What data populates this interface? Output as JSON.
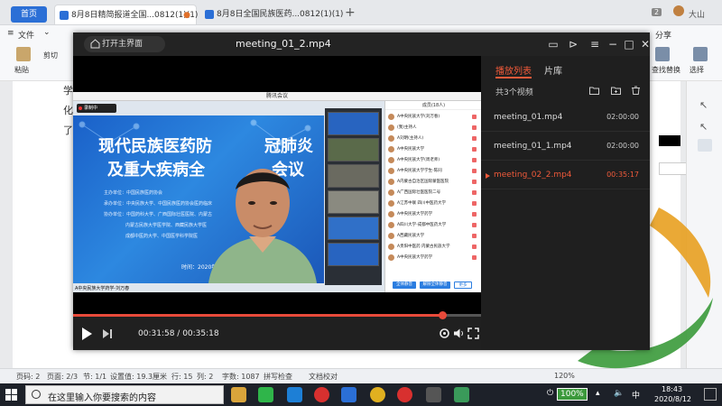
{
  "wps": {
    "home_tab": "首页",
    "doc_tabs": [
      {
        "label": "8月8日精简报道全国...0812(1)(1)"
      },
      {
        "label": "8月8日全国民族医药...0812(1)(1)"
      }
    ],
    "tab_count": "2",
    "user_name": "大山",
    "ribbon": {
      "file_menu": "文件",
      "paste": "粘贴",
      "cut": "剪切",
      "share": "分享",
      "find_replace": "查找替换",
      "select": "选择"
    },
    "doc_text": [
      "学",
      "化",
      "了"
    ]
  },
  "statusbar": {
    "page_no": "页码: 2",
    "pages": "页面: 2/3",
    "section": "节: 1/1",
    "setting": "设置值: 19.3厘米",
    "row": "行: 15",
    "col": "列: 2",
    "word_count": "字数: 1087",
    "spell_check": "拼写检查",
    "doc_check": "文档校对",
    "zoom": "120%"
  },
  "player": {
    "home_button": "打开主界面",
    "file_name": "meeting_01_2.mp4",
    "current_time": "00:31:58",
    "total_time": "00:35:18",
    "progress": 0.905,
    "side_tabs": {
      "playlist": "播放列表",
      "library": "片库"
    },
    "video_count": "共3个视频",
    "videos": [
      {
        "name": "meeting_01.mp4",
        "duration": "02:00:00"
      },
      {
        "name": "meeting_01_1.mp4",
        "duration": "02:00:00"
      },
      {
        "name": "meeting_02_2.mp4",
        "duration": "00:35:17"
      }
    ],
    "playing_index": 2
  },
  "meeting": {
    "window_title": "腾讯会议",
    "rec_label": "录制中",
    "slide_title_1": "现代民族医药防",
    "slide_title_1b": "冠肺炎",
    "slide_title_2": "及重大疾病全",
    "slide_title_2b": "会议",
    "slide_lines": [
      "主办单位：中国民族医药协会",
      "承办单位：中央民族大学、中国民族医药协会医药临床",
      "协办单位：中国药科大学、广西国际壮医医院、内蒙古",
      "内蒙古民族大学医学院、西藏民族大学医",
      "成都中医药大学、中国医学科学院医"
    ],
    "slide_time": "时间：2020年8月",
    "caption": "A中央民族大学药学-刘万春",
    "participants_title": "成员(18人)",
    "participants": [
      "A中央民族大学(刘万春)",
      "(我)主持人",
      "A刘明(主持人)",
      "A中央民族大学",
      "A中央民族大学(周老师)",
      "A中央民族大学学生-陈同",
      "A内蒙古自治区国际蒙医医院",
      "A广西国际壮医医院二号",
      "A江苏中联 四川中医药大学",
      "A中央民族大学药学",
      "A四川大学-成都中医药大学",
      "A西藏民族大学",
      "A贵阳中医药 内蒙古民族大学",
      "A中央民族大学药学"
    ],
    "btn_mute_all": "全体静音",
    "btn_unmute_all": "解除全体静音",
    "btn_more": "更多"
  },
  "taskbar": {
    "search_placeholder": "在这里输入你要搜索的内容",
    "battery": "100%",
    "ime": "中",
    "time": "18:43",
    "date": "2020/8/12"
  },
  "colors": {
    "accent_orange": "#f05a3a",
    "wps_blue": "#2b6fd6",
    "progress_red": "#e84a3a"
  }
}
